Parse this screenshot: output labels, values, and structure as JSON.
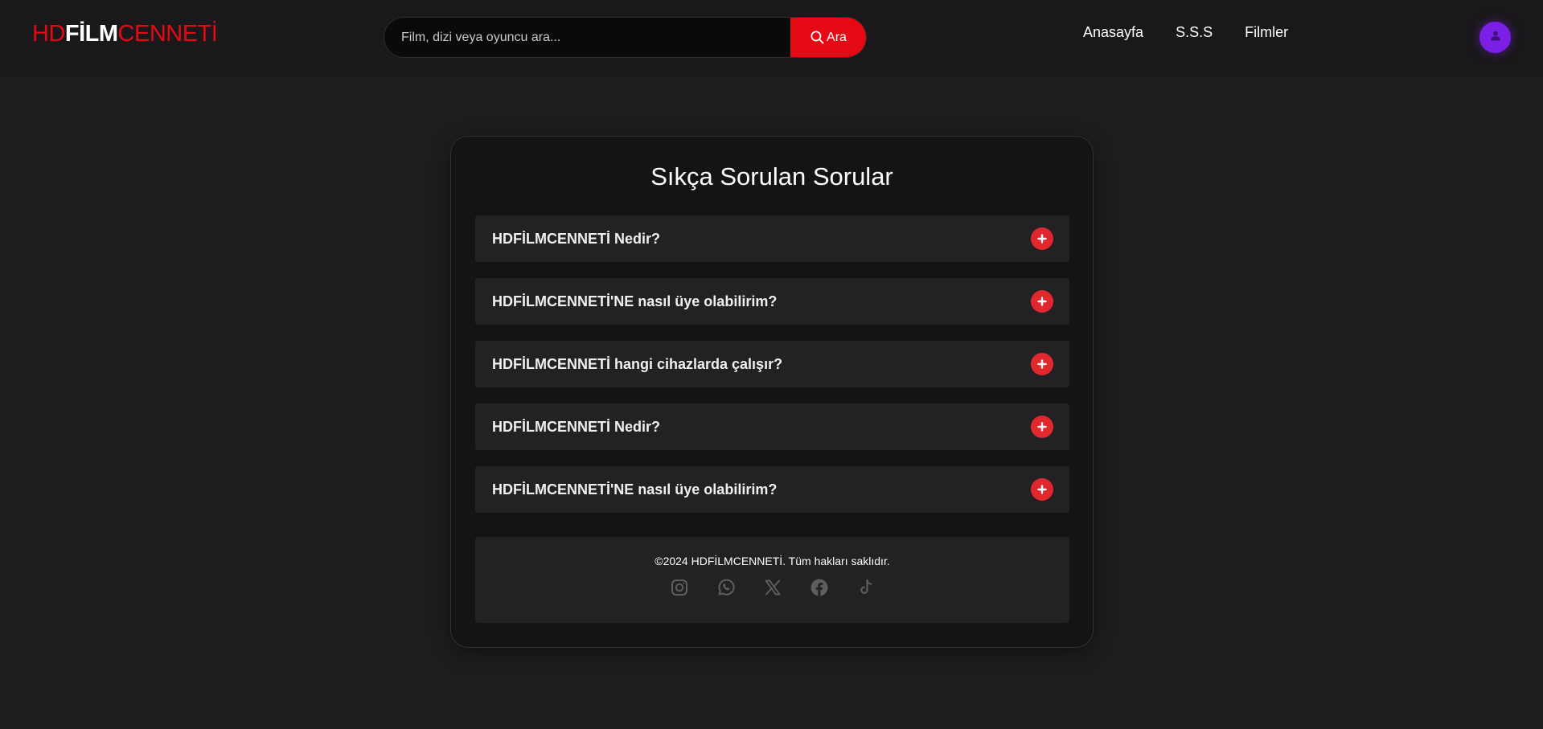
{
  "header": {
    "logo": {
      "hd": "HD",
      "film": "FİLM",
      "cenneti": "CENNETİ"
    },
    "search": {
      "placeholder": "Film, dizi veya oyuncu ara...",
      "value": "",
      "button_label": "Ara"
    },
    "nav": [
      {
        "label": "Anasayfa"
      },
      {
        "label": "S.S.S"
      },
      {
        "label": "Filmler"
      }
    ],
    "avatar_icon": "user-icon"
  },
  "faq": {
    "title": "Sıkça Sorulan Sorular",
    "items": [
      {
        "question": "HDFİLMCENNETİ Nedir?"
      },
      {
        "question": "HDFİLMCENNETİ'NE nasıl üye olabilirim?"
      },
      {
        "question": "HDFİLMCENNETİ hangi cihazlarda çalışır?"
      },
      {
        "question": "HDFİLMCENNETİ Nedir?"
      },
      {
        "question": "HDFİLMCENNETİ'NE nasıl üye olabilirim?"
      }
    ],
    "toggle_icon": "plus-circle-icon"
  },
  "footer": {
    "copyright": "©2024 HDFİLMCENNETİ. Tüm hakları saklıdır.",
    "socials": [
      {
        "icon": "instagram-icon"
      },
      {
        "icon": "whatsapp-icon"
      },
      {
        "icon": "x-twitter-icon"
      },
      {
        "icon": "facebook-icon"
      },
      {
        "icon": "tiktok-icon"
      }
    ]
  },
  "colors": {
    "brand_red": "#e50914",
    "background": "#1f1d1f",
    "header_bg": "#1a181a",
    "card_bg": "#151415",
    "item_bg": "#232123",
    "toggle_red": "#e0282e",
    "avatar_purple": "#7b1fe6",
    "social_icon_gray": "#5f5d60"
  }
}
